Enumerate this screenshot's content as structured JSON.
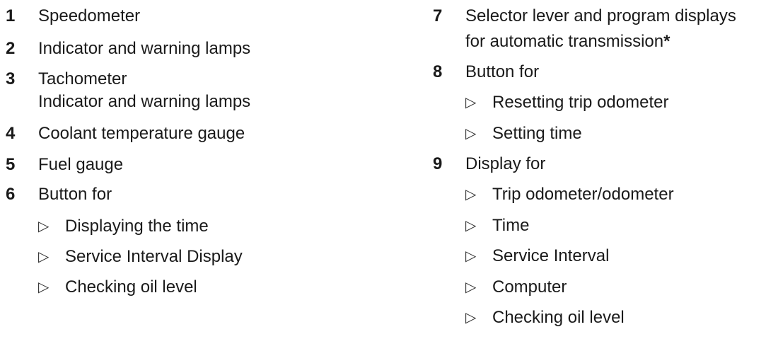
{
  "left_items": [
    {
      "num": "1",
      "lines": [
        "Speedometer"
      ],
      "subs": []
    },
    {
      "num": "2",
      "lines": [
        "Indicator and warning lamps"
      ],
      "subs": []
    },
    {
      "num": "3",
      "lines": [
        "Tachometer",
        "Indicator and warning lamps"
      ],
      "subs": []
    },
    {
      "num": "4",
      "lines": [
        "Coolant temperature gauge"
      ],
      "subs": []
    },
    {
      "num": "5",
      "lines": [
        "Fuel gauge"
      ],
      "subs": []
    },
    {
      "num": "6",
      "lines": [
        "Button for"
      ],
      "subs": [
        "Displaying the time",
        "Service Interval Display",
        "Checking oil level"
      ]
    }
  ],
  "right_items": [
    {
      "num": "7",
      "lines": [
        "Selector lever and program displays",
        "for automatic transmission"
      ],
      "star": "*",
      "subs": []
    },
    {
      "num": "8",
      "lines": [
        "Button for"
      ],
      "subs": [
        "Resetting trip odometer",
        "Setting time"
      ]
    },
    {
      "num": "9",
      "lines": [
        "Display for"
      ],
      "subs": [
        "Trip odometer/odometer",
        "Time",
        "Service Interval",
        "Computer",
        "Checking oil level"
      ]
    }
  ],
  "bullet_glyph": "▷"
}
